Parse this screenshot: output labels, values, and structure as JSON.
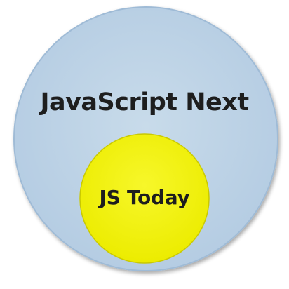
{
  "outer_circle": {
    "label": "JavaScript Next",
    "fill": "#bdd3e6",
    "stroke": "#9fbbd6",
    "text_color": "#1e1e1e"
  },
  "inner_circle": {
    "label": "JS Today",
    "fill": "#f2f20a",
    "stroke": "#c9c900",
    "text_color": "#1e1e1e"
  }
}
